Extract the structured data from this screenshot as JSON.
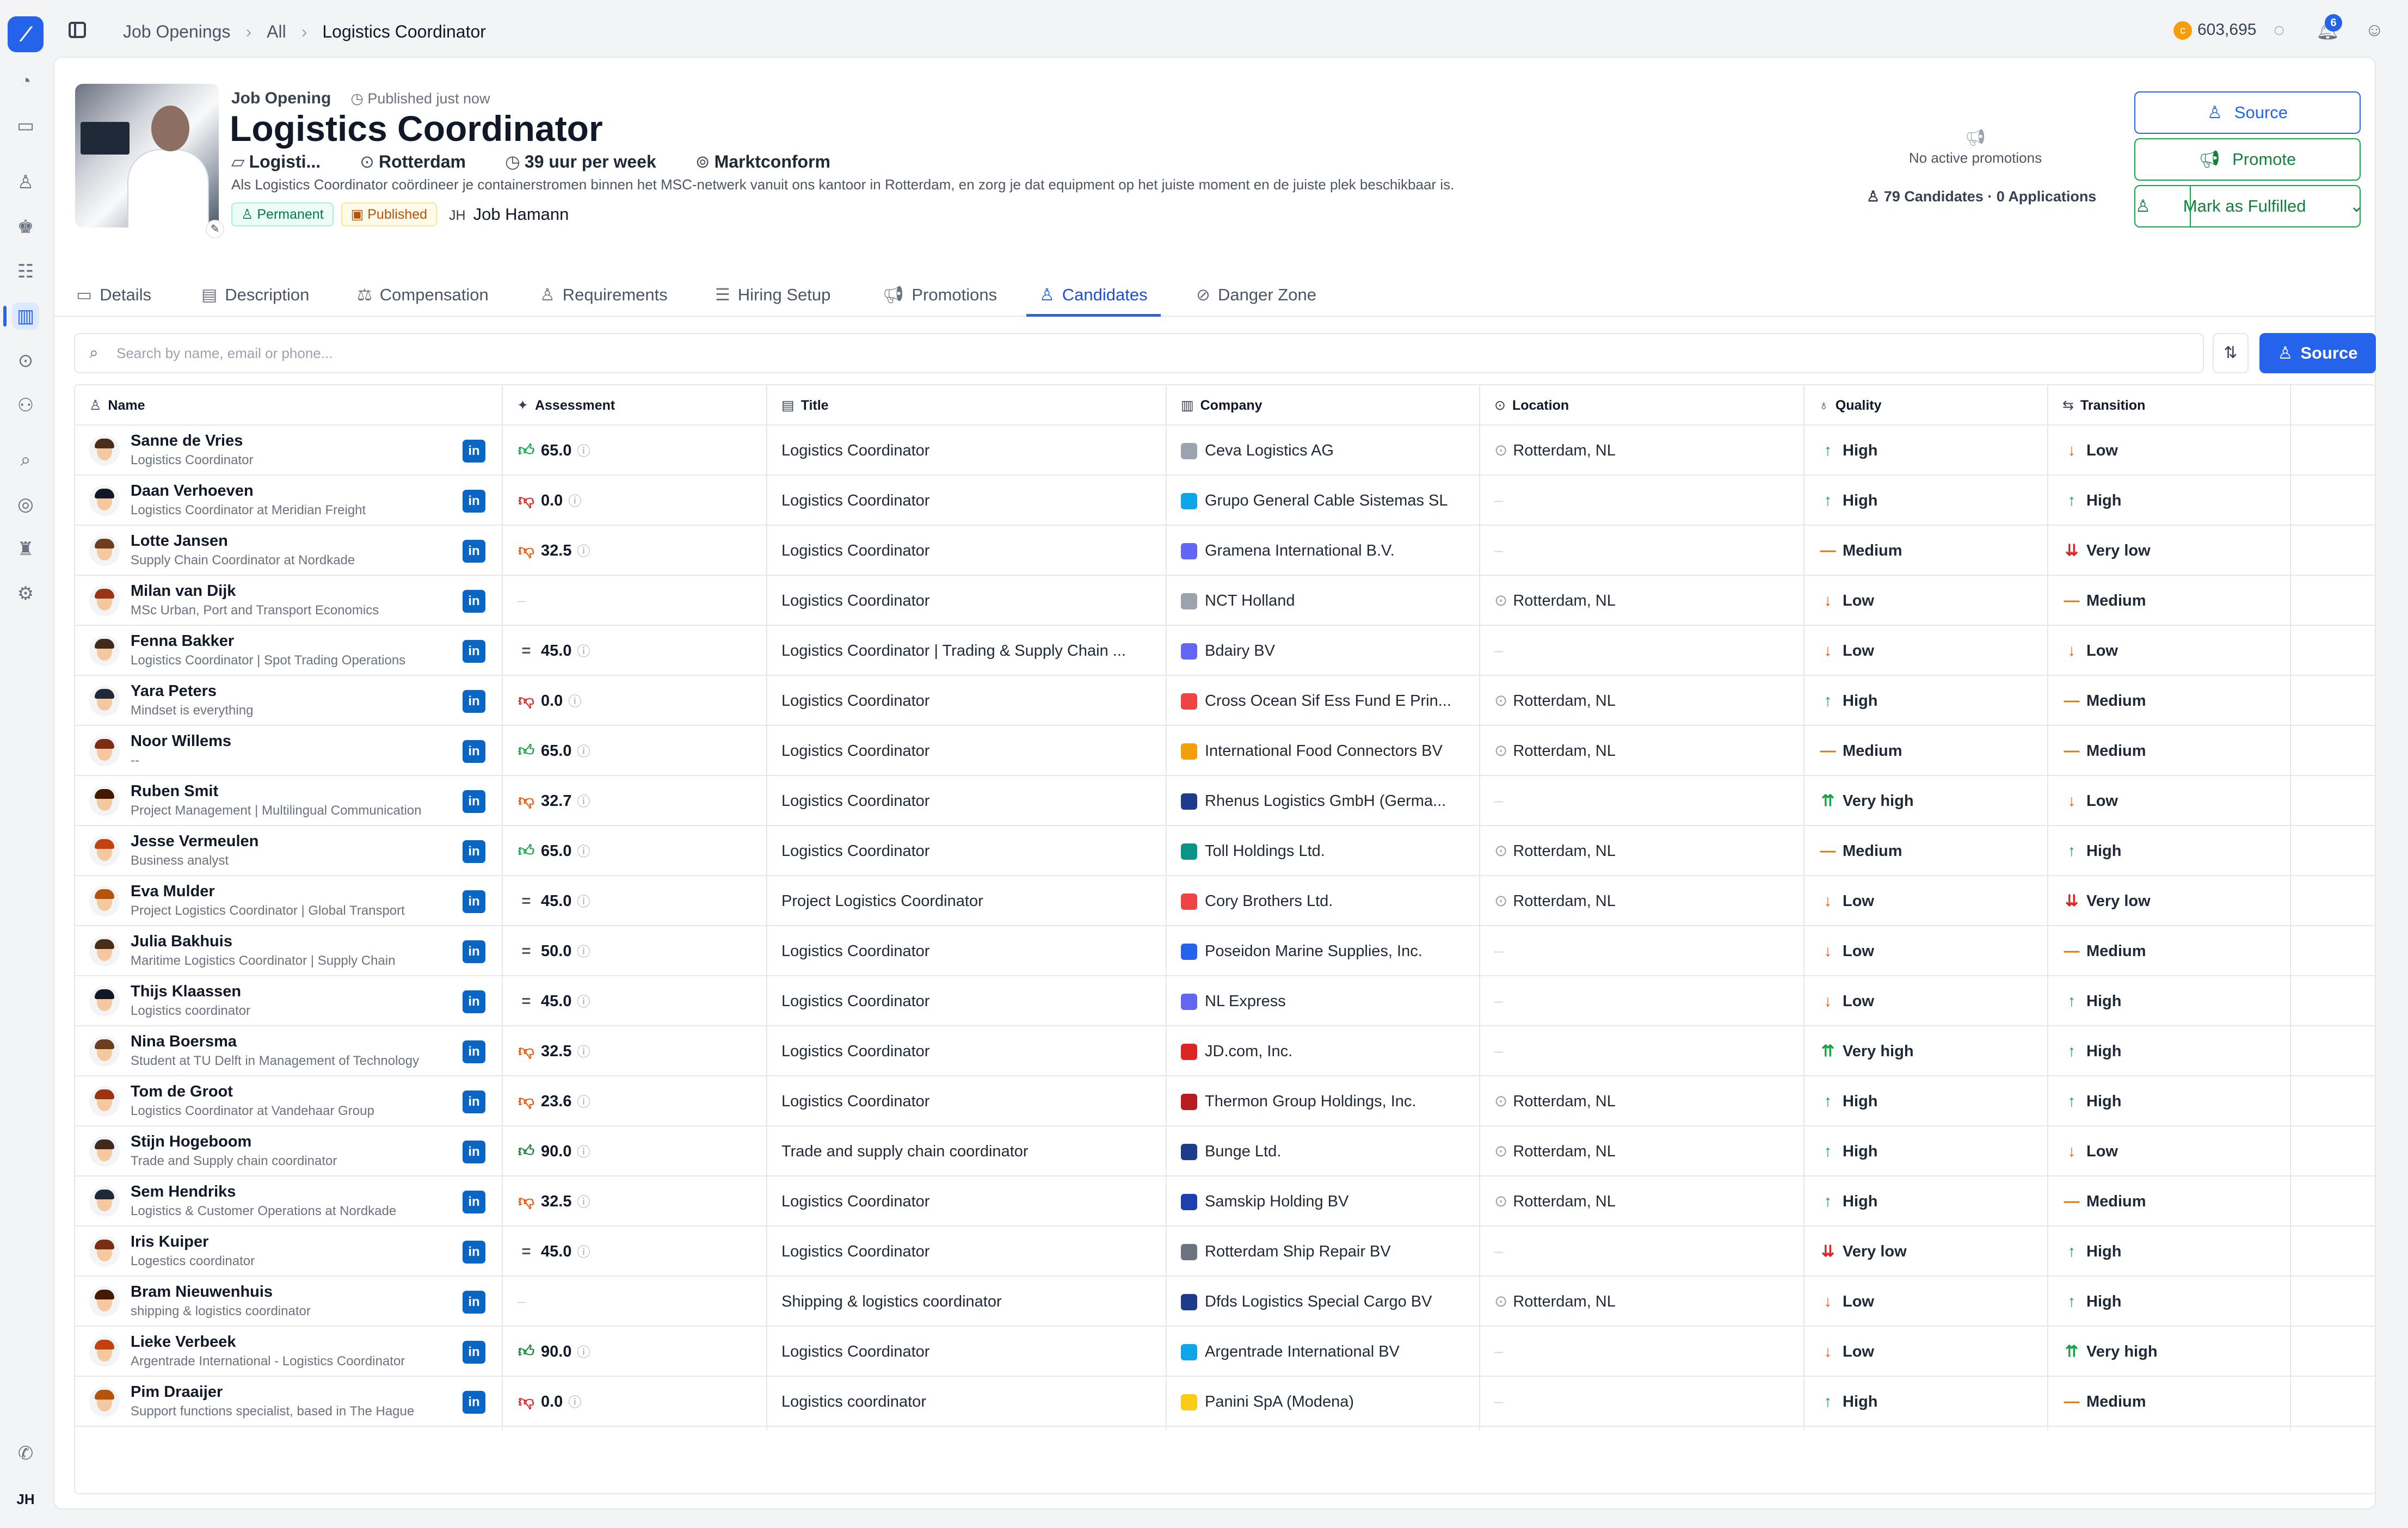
{
  "topbar": {
    "breadcrumb": [
      "Job Openings",
      "All",
      "Logistics Coordinator"
    ],
    "credits": "603,695",
    "notifications": "6"
  },
  "rail": {
    "icons": [
      "dashboard-icon",
      "inbox-icon",
      "person-icon",
      "people-icon",
      "contacts-icon",
      "jobs-icon",
      "location-icon",
      "org-icon",
      "search-icon",
      "target-icon",
      "user-settings-icon",
      "settings-icon",
      "phone-icon"
    ],
    "user_initials": "JH"
  },
  "job": {
    "label": "Job Opening",
    "published": "Published just now",
    "title": "Logistics Coordinator",
    "department": "Logisti...",
    "location": "Rotterdam",
    "hours": "39 uur per week",
    "salary": "Marktconform",
    "description": "Als Logistics Coordinator coördineer je containerstromen binnen het MSC-netwerk vanuit ons kantoor in Rotterdam, en zorg je dat equipment op het juiste moment en de juiste plek beschikbaar is.",
    "badges": [
      "Permanent",
      "Published"
    ],
    "owner_initials": "JH",
    "owner_name": "Job Hamann",
    "promotions": "No active promotions",
    "candidates_count": "79 Candidates",
    "applications_count": "0 Applications"
  },
  "actions": {
    "source": "Source",
    "promote": "Promote",
    "fulfill": "Mark as Fulfilled"
  },
  "tabs": [
    {
      "label": "Details",
      "icon": "details-icon"
    },
    {
      "label": "Description",
      "icon": "document-icon"
    },
    {
      "label": "Compensation",
      "icon": "compensation-icon"
    },
    {
      "label": "Requirements",
      "icon": "requirements-icon"
    },
    {
      "label": "Hiring Setup",
      "icon": "list-icon"
    },
    {
      "label": "Promotions",
      "icon": "megaphone-icon"
    },
    {
      "label": "Candidates",
      "icon": "candidates-icon",
      "active": true
    },
    {
      "label": "Danger Zone",
      "icon": "warning-icon"
    }
  ],
  "search": {
    "placeholder": "Search by name, email or phone...",
    "source_button": "Source"
  },
  "table": {
    "headers": [
      "Name",
      "Assessment",
      "Title",
      "Company",
      "Location",
      "Quality",
      "Transition"
    ],
    "rows": [
      {
        "name": "Sanne de Vries",
        "sub": "Logistics Coordinator",
        "assess": "65.0",
        "atype": "up",
        "title": "Logistics Coordinator",
        "company": "Ceva Logistics AG",
        "clogo": "#9ca3af",
        "location": "Rotterdam, NL",
        "quality": "High",
        "transition": "Low"
      },
      {
        "name": "Daan Verhoeven",
        "sub": "Logistics Coordinator at Meridian Freight",
        "assess": "0.0",
        "atype": "down",
        "title": "Logistics Coordinator",
        "company": "Grupo General Cable Sistemas SL",
        "clogo": "#0ea5e9",
        "location": "",
        "quality": "High",
        "transition": "High"
      },
      {
        "name": "Lotte Jansen",
        "sub": "Supply Chain Coordinator at Nordkade",
        "assess": "32.5",
        "atype": "weak",
        "title": "Logistics Coordinator",
        "company": "Gramena International B.V.",
        "clogo": "#6366f1",
        "location": "",
        "quality": "Medium",
        "transition": "Very low"
      },
      {
        "name": "Milan van Dijk",
        "sub": "MSc Urban, Port and Transport Economics",
        "assess": "",
        "atype": "",
        "title": "Logistics Coordinator",
        "company": "NCT Holland",
        "clogo": "#9ca3af",
        "location": "Rotterdam, NL",
        "quality": "Low",
        "transition": "Medium"
      },
      {
        "name": "Fenna Bakker",
        "sub": "Logistics Coordinator | Spot Trading Operations",
        "assess": "45.0",
        "atype": "eq",
        "title": "Logistics Coordinator | Trading & Supply Chain ...",
        "company": "Bdairy BV",
        "clogo": "#6366f1",
        "location": "",
        "quality": "Low",
        "transition": "Low"
      },
      {
        "name": "Yara Peters",
        "sub": "Mindset is everything",
        "assess": "0.0",
        "atype": "down",
        "title": "Logistics Coordinator",
        "company": "Cross Ocean Sif Ess Fund E Prin...",
        "clogo": "#ef4444",
        "location": "Rotterdam, NL",
        "quality": "High",
        "transition": "Medium"
      },
      {
        "name": "Noor Willems",
        "sub": "--",
        "assess": "65.0",
        "atype": "up",
        "title": "Logistics Coordinator",
        "company": "International Food Connectors BV",
        "clogo": "#f59e0b",
        "location": "Rotterdam, NL",
        "quality": "Medium",
        "transition": "Medium"
      },
      {
        "name": "Ruben Smit",
        "sub": "Project Management | Multilingual Communication",
        "assess": "32.7",
        "atype": "weak",
        "title": "Logistics Coordinator",
        "company": "Rhenus Logistics GmbH (Germa...",
        "clogo": "#1e3a8a",
        "location": "",
        "quality": "Very high",
        "transition": "Low"
      },
      {
        "name": "Jesse Vermeulen",
        "sub": "Business analyst",
        "assess": "65.0",
        "atype": "up",
        "title": "Logistics Coordinator",
        "company": "Toll Holdings Ltd.",
        "clogo": "#0d9488",
        "location": "Rotterdam, NL",
        "quality": "Medium",
        "transition": "High"
      },
      {
        "name": "Eva Mulder",
        "sub": "Project Logistics Coordinator | Global Transport",
        "assess": "45.0",
        "atype": "eq",
        "title": "Project Logistics Coordinator",
        "company": "Cory Brothers Ltd.",
        "clogo": "#ef4444",
        "location": "Rotterdam, NL",
        "quality": "Low",
        "transition": "Very low"
      },
      {
        "name": "Julia Bakhuis",
        "sub": "Maritime Logistics Coordinator | Supply Chain",
        "assess": "50.0",
        "atype": "eq",
        "title": "Logistics Coordinator",
        "company": "Poseidon Marine Supplies, Inc.",
        "clogo": "#2563eb",
        "location": "",
        "quality": "Low",
        "transition": "Medium"
      },
      {
        "name": "Thijs Klaassen",
        "sub": "Logistics coordinator",
        "assess": "45.0",
        "atype": "eq",
        "title": "Logistics Coordinator",
        "company": "NL Express",
        "clogo": "#6366f1",
        "location": "",
        "quality": "Low",
        "transition": "High"
      },
      {
        "name": "Nina Boersma",
        "sub": "Student at TU Delft in Management of Technology",
        "assess": "32.5",
        "atype": "weak",
        "title": "Logistics Coordinator",
        "company": "JD.com, Inc.",
        "clogo": "#dc2626",
        "location": "",
        "quality": "Very high",
        "transition": "High"
      },
      {
        "name": "Tom de Groot",
        "sub": "Logistics Coordinator at Vandehaar Group",
        "assess": "23.6",
        "atype": "weak",
        "title": "Logistics Coordinator",
        "company": "Thermon Group Holdings, Inc.",
        "clogo": "#b91c1c",
        "location": "Rotterdam, NL",
        "quality": "High",
        "transition": "High"
      },
      {
        "name": "Stijn Hogeboom",
        "sub": "Trade and Supply chain coordinator",
        "assess": "90.0",
        "atype": "strong",
        "title": "Trade and supply chain coordinator",
        "company": "Bunge Ltd.",
        "clogo": "#1e3a8a",
        "location": "Rotterdam, NL",
        "quality": "High",
        "transition": "Low"
      },
      {
        "name": "Sem Hendriks",
        "sub": "Logistics & Customer Operations at Nordkade",
        "assess": "32.5",
        "atype": "weak",
        "title": "Logistics Coordinator",
        "company": "Samskip Holding BV",
        "clogo": "#1e40af",
        "location": "Rotterdam, NL",
        "quality": "High",
        "transition": "Medium"
      },
      {
        "name": "Iris Kuiper",
        "sub": "Logestics coordinator",
        "assess": "45.0",
        "atype": "eq",
        "title": "Logistics Coordinator",
        "company": "Rotterdam Ship Repair BV",
        "clogo": "#6b7280",
        "location": "",
        "quality": "Very low",
        "transition": "High"
      },
      {
        "name": "Bram Nieuwenhuis",
        "sub": "shipping & logistics coordinator",
        "assess": "",
        "atype": "",
        "title": "Shipping & logistics coordinator",
        "company": "Dfds Logistics Special Cargo BV",
        "clogo": "#1e3a8a",
        "location": "Rotterdam, NL",
        "quality": "Low",
        "transition": "High"
      },
      {
        "name": "Lieke Verbeek",
        "sub": "Argentrade International - Logistics Coordinator",
        "assess": "90.0",
        "atype": "strong",
        "title": "Logistics Coordinator",
        "company": "Argentrade International BV",
        "clogo": "#0ea5e9",
        "location": "",
        "quality": "Low",
        "transition": "Very high"
      },
      {
        "name": "Pim Draaijer",
        "sub": "Support functions specialist, based in The Hague",
        "assess": "0.0",
        "atype": "down",
        "title": "Logistics coordinator",
        "company": "Panini SpA (Modena)",
        "clogo": "#facc15",
        "location": "",
        "quality": "High",
        "transition": "Medium"
      }
    ]
  }
}
